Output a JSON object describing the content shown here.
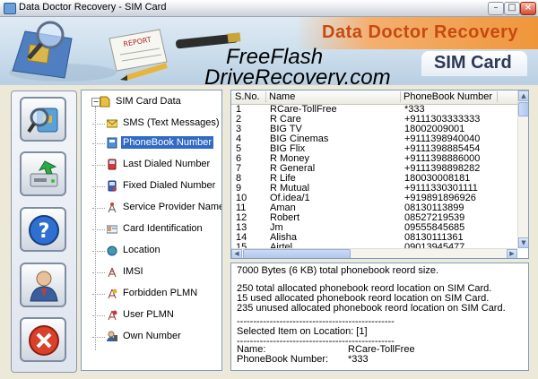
{
  "window": {
    "title": "Data Doctor Recovery - SIM Card",
    "min": "–",
    "max": "□",
    "close": "×"
  },
  "header": {
    "app_name": "Data Doctor Recovery",
    "subtitle": "SIM Card",
    "watermark_line1": "FreeFlash",
    "watermark_line2": "DriveRecovery.com",
    "report_stamp": "REPORT"
  },
  "toolbar": {
    "buttons": [
      "search-sim-icon",
      "save-drive-icon",
      "help-icon",
      "user-icon",
      "exit-icon"
    ]
  },
  "tree": {
    "root": "SIM Card Data",
    "expander": "−",
    "items": [
      {
        "label": "SMS (Text Messages)",
        "icon": "envelope-icon"
      },
      {
        "label": "PhoneBook Number",
        "icon": "phonebook-icon",
        "selected": true
      },
      {
        "label": "Last Dialed Number",
        "icon": "phone-red-icon"
      },
      {
        "label": "Fixed Dialed Number",
        "icon": "phone-blue-icon"
      },
      {
        "label": "Service Provider Name",
        "icon": "antenna-icon"
      },
      {
        "label": "Card Identification",
        "icon": "id-card-icon"
      },
      {
        "label": "Location",
        "icon": "globe-icon"
      },
      {
        "label": "IMSI",
        "icon": "tower-icon"
      },
      {
        "label": "Forbidden PLMN",
        "icon": "tower-forbidden-icon"
      },
      {
        "label": "User PLMN",
        "icon": "tower-user-icon"
      },
      {
        "label": "Own Number",
        "icon": "person-phone-icon"
      }
    ]
  },
  "table": {
    "columns": [
      "S.No.",
      "Name",
      "PhoneBook Number"
    ],
    "rows": [
      [
        "1",
        "RCare-TollFree",
        "*333"
      ],
      [
        "2",
        "R Care",
        "+9111303333333"
      ],
      [
        "3",
        "BIG TV",
        "18002009001"
      ],
      [
        "4",
        "BIG Cinemas",
        "+9111398940040"
      ],
      [
        "5",
        "BIG Flix",
        "+9111398885454"
      ],
      [
        "6",
        "R Money",
        "+9111398886000"
      ],
      [
        "7",
        "R General",
        "+9111398898282"
      ],
      [
        "8",
        "R Life",
        "180030008181"
      ],
      [
        "9",
        "R Mutual",
        "+9111330301111"
      ],
      [
        "10",
        "Of.idea/1",
        "+919891896926"
      ],
      [
        "11",
        "Aman",
        "08130113899"
      ],
      [
        "12",
        "Robert",
        "08527219539"
      ],
      [
        "13",
        "Jm",
        "09555845685"
      ],
      [
        "14",
        "Alisha",
        "08130111361"
      ],
      [
        "15",
        "Airtel",
        "09013945477"
      ]
    ]
  },
  "info": {
    "size_line": "7000 Bytes (6 KB) total phonebook reord size.",
    "total_line": "250 total allocated phonebook reord location on SIM Card.",
    "used_line": "15 used allocated phonebook reord location on SIM Card.",
    "unused_line": "235 unused allocated phonebook reord location on SIM Card.",
    "divider1": "------------------------------------------------",
    "selected_line": "Selected Item on Location: [1]",
    "divider2": "------------------------------------------------",
    "name_label": "Name:",
    "name_value": "RCare-TollFree",
    "number_label": "PhoneBook Number:",
    "number_value": "*333"
  }
}
